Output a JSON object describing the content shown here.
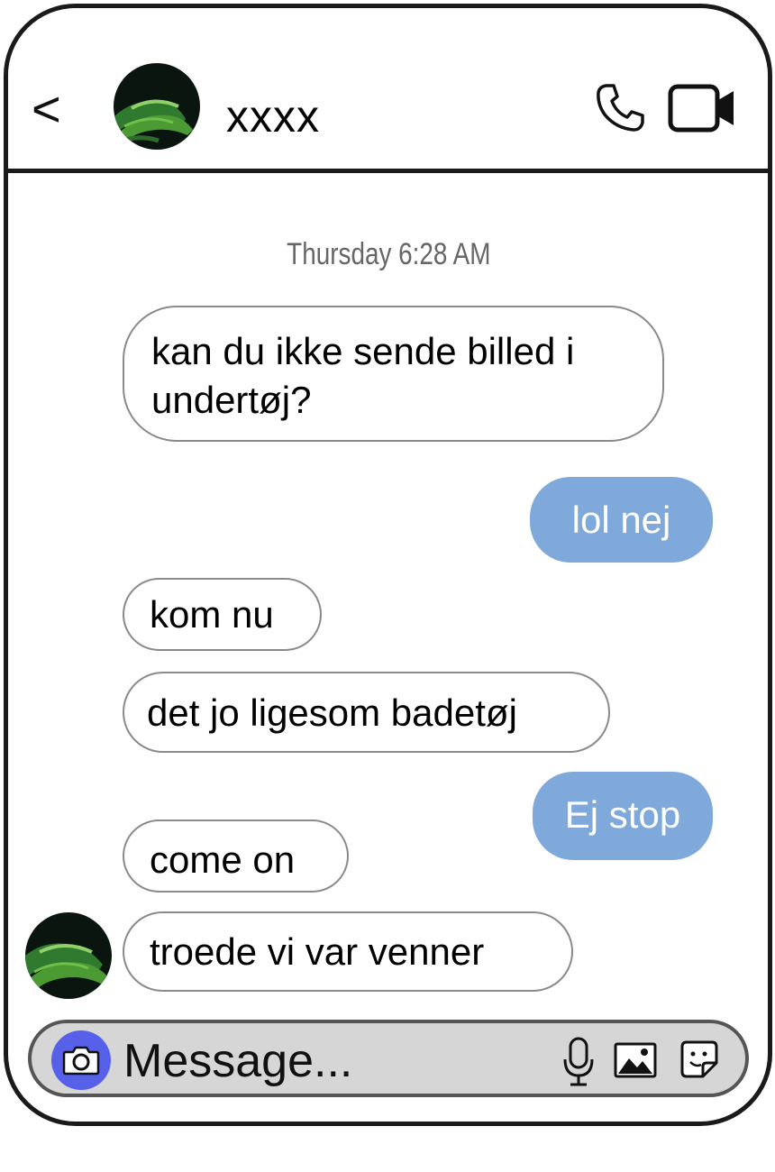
{
  "header": {
    "back_label": "<",
    "contact_name": "xxxx",
    "icons": [
      "chevron-left-icon",
      "phone-icon",
      "video-camera-icon"
    ]
  },
  "conversation": {
    "timestamp": "Thursday 6:28 AM",
    "messages": [
      {
        "direction": "incoming",
        "text": "kan du ikke sende billed i undertøj?"
      },
      {
        "direction": "outgoing",
        "text": "lol nej"
      },
      {
        "direction": "incoming",
        "text": "kom nu"
      },
      {
        "direction": "incoming",
        "text": "det jo ligesom badetøj"
      },
      {
        "direction": "outgoing",
        "text": "Ej stop"
      },
      {
        "direction": "incoming",
        "text": "come on"
      },
      {
        "direction": "incoming",
        "text": "troede vi var venner"
      }
    ]
  },
  "composer": {
    "placeholder": "Message...",
    "icons": [
      "camera-icon",
      "microphone-icon",
      "image-icon",
      "sticker-icon"
    ]
  },
  "colors": {
    "outgoing_bubble": "#7fa8db",
    "incoming_border": "#8a8a8a",
    "camera_button": "#5760e8",
    "composer_background": "#d6d6d6",
    "frame": "#1a1a1a"
  }
}
